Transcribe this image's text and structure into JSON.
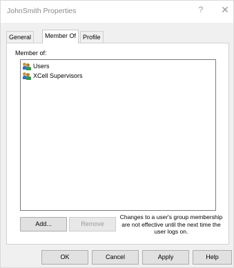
{
  "window": {
    "title": "JohnSmith Properties",
    "help_glyph": "?",
    "close_glyph": "✕"
  },
  "tabs": [
    {
      "label": "General",
      "active": false
    },
    {
      "label": "Member Of",
      "active": true
    },
    {
      "label": "Profile",
      "active": false
    }
  ],
  "member_of": {
    "label": "Member of:",
    "items": [
      {
        "name": "Users",
        "icon": "group-icon"
      },
      {
        "name": "XCell Supervisors",
        "icon": "group-icon"
      }
    ],
    "add_label": "Add...",
    "remove_label": "Remove",
    "note": "Changes to a user's group membership are not effective until the next time the user logs on."
  },
  "footer": {
    "ok_label": "OK",
    "cancel_label": "Cancel",
    "apply_label": "Apply",
    "help_label": "Help"
  }
}
